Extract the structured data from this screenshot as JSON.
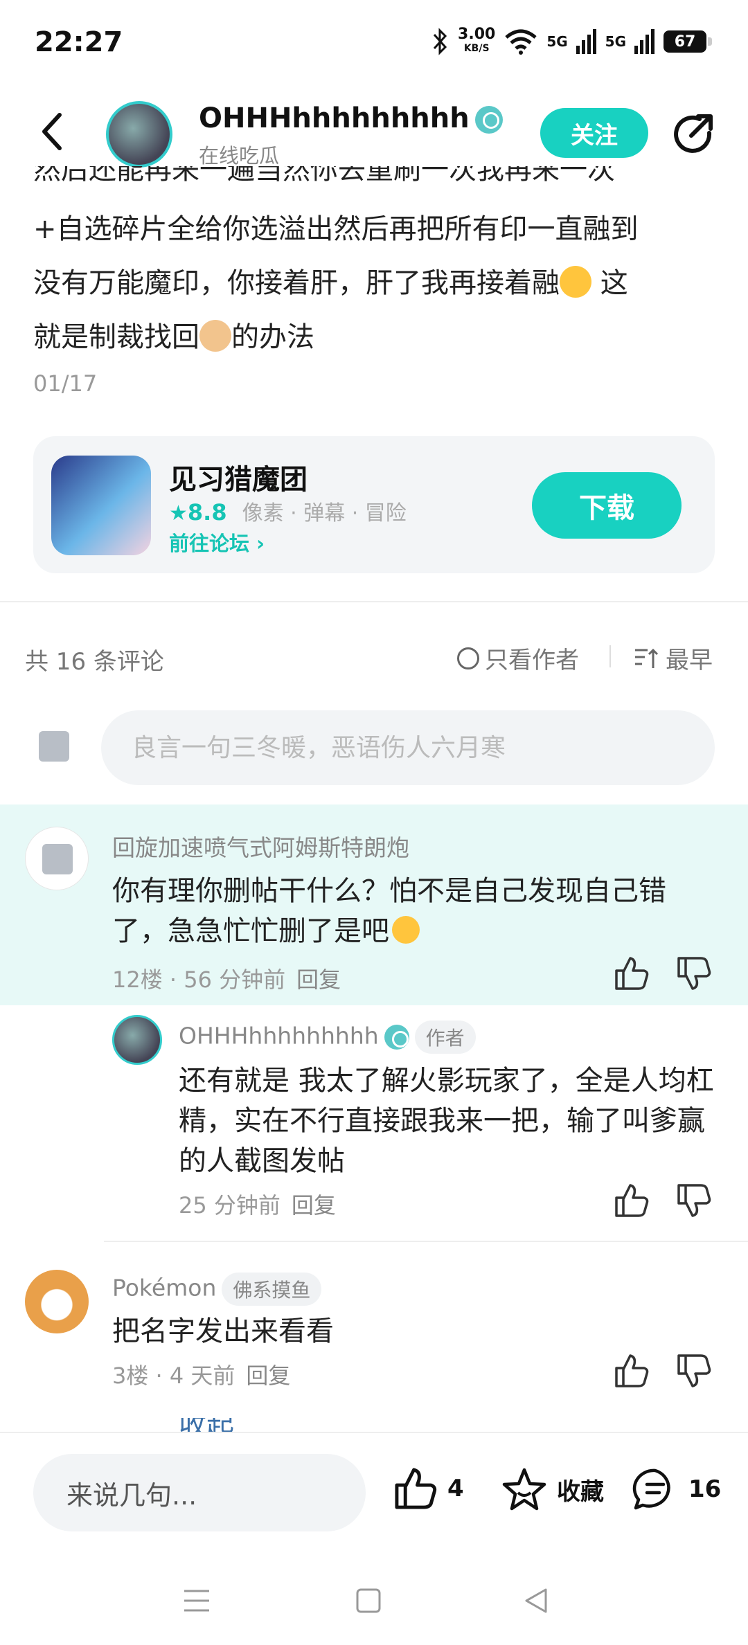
{
  "status_bar": {
    "time": "22:27",
    "net_speed": "3.00",
    "net_unit": "KB/S",
    "signal_1": "5G",
    "signal_2": "5G",
    "battery": "67"
  },
  "header": {
    "name": "OHHHhhhhhhhhh",
    "subtitle": "在线吃瓜",
    "follow_label": "关注"
  },
  "post": {
    "text_top_cut": "然后还能再来一遍当然你去重刷一次我再来一次",
    "text_line1": "+自选碎片全给你选溢出然后再把所有印一直融到",
    "text_line2a": "没有万能魔印，你接着肝，肝了我再接着融",
    "text_line2b": " 这",
    "text_line3a": "就是制裁找回",
    "text_line3b": "的办法",
    "date": "01/17"
  },
  "app_card": {
    "name": "见习猎魔团",
    "star": "★",
    "rating": "8.8",
    "tags": "像素 · 弹幕 · 冒险",
    "forum_link": "前往论坛",
    "forum_chevron": "›",
    "download_label": "下载"
  },
  "comments_header": {
    "count_label": "共 16 条评论",
    "author_only": "只看作者",
    "sort_label": "最早"
  },
  "comment_input": {
    "placeholder": "良言一句三冬暖，恶语伤人六月寒"
  },
  "comments": [
    {
      "name": "回旋加速喷气式阿姆斯特朗炮",
      "text_a": "你有理你删帖干什么？怕不是自己发现自己错",
      "text_b": "了，急急忙忙删了是吧",
      "meta": "12楼 · 56 分钟前",
      "reply": "回复"
    },
    {
      "name": "OHHHhhhhhhhhh",
      "tag": "作者",
      "text": "还有就是 我太了解火影玩家了，全是人均杠精，实在不行直接跟我来一把，输了叫爹赢的人截图发帖",
      "meta": "25 分钟前",
      "reply": "回复"
    },
    {
      "name": "Pokémon",
      "tag": "佛系摸鱼",
      "text": "把名字发出来看看",
      "meta": "3楼 · 4 天前",
      "reply": "回复"
    }
  ],
  "collapse_label": "收起",
  "bottom_bar": {
    "input_placeholder": "来说几句...",
    "likes": "4",
    "favorite_label": "收藏",
    "comments": "16"
  },
  "icons": [
    "back-icon",
    "share-icon",
    "verified-icon",
    "like-icon",
    "dislike-icon",
    "star-icon",
    "comment-icon",
    "sort-icon"
  ],
  "colors": {
    "accent": "#18d1c1",
    "highlight": "#e7f9f7",
    "link": "#3a6fa8"
  }
}
